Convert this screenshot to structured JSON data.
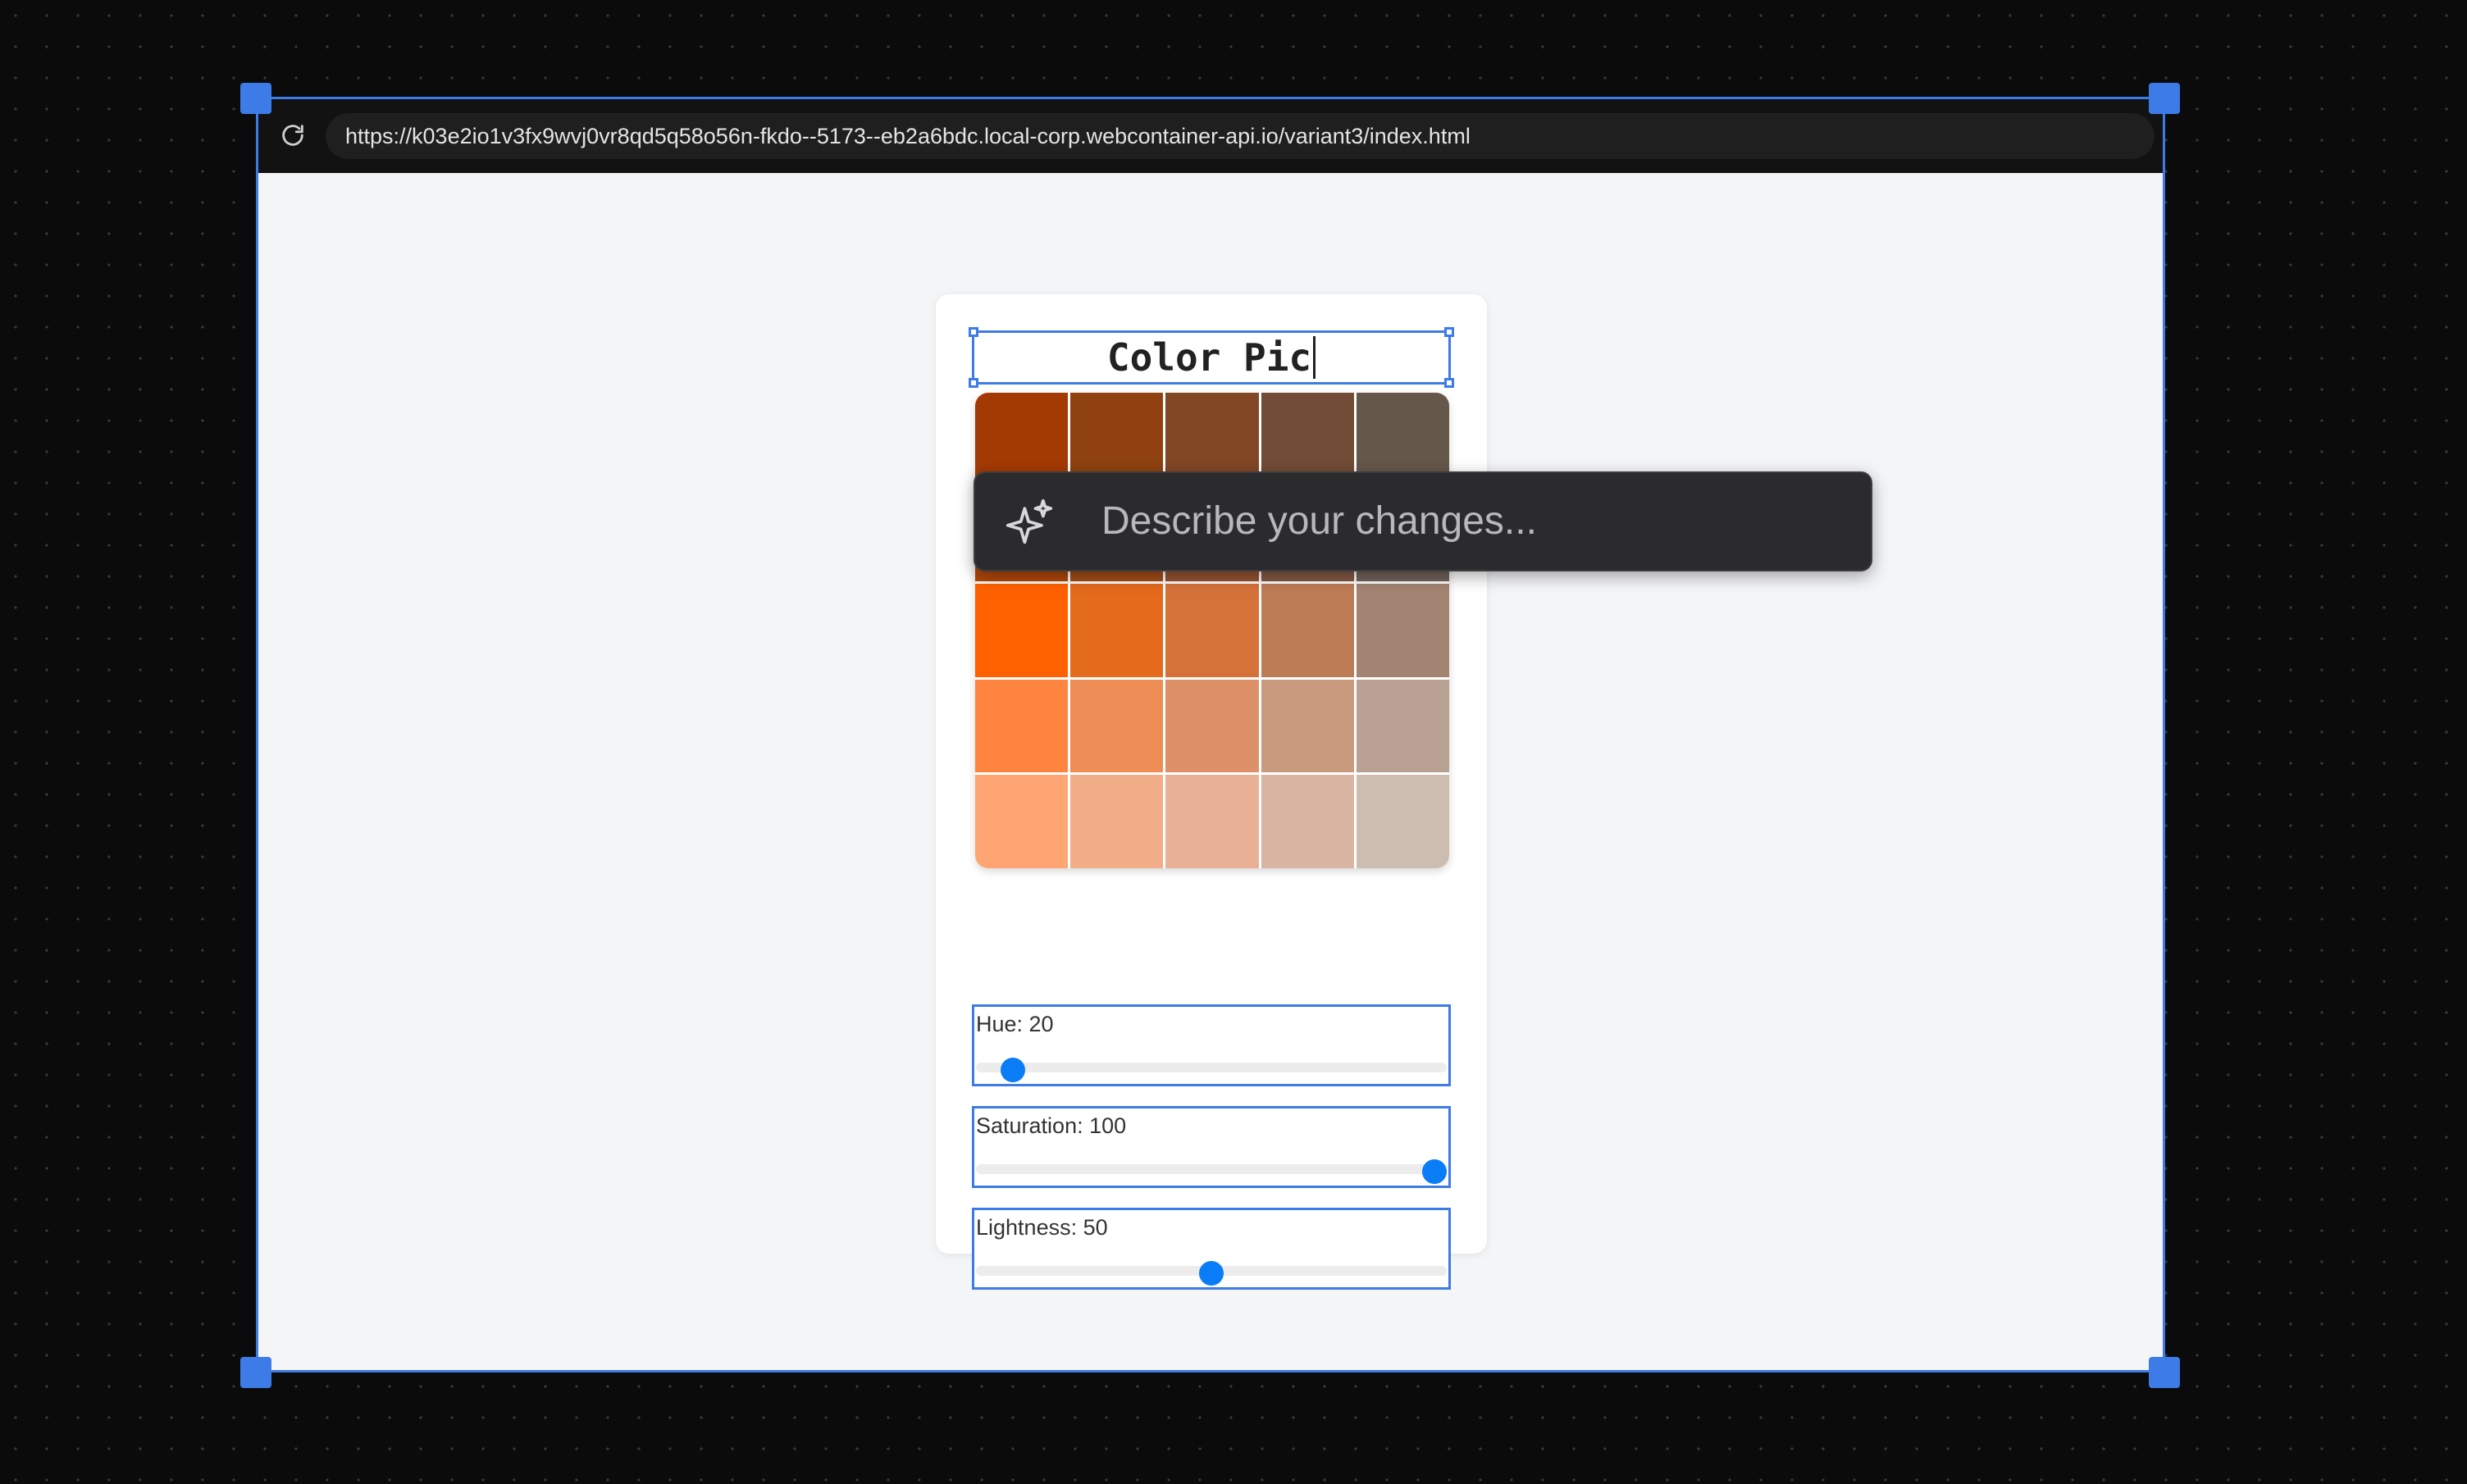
{
  "browser": {
    "url": "https://k03e2io1v3fx9wvj0vr8qd5q58o56n-fkdo--5173--eb2a6bdc.local-corp.webcontainer-api.io/variant3/index.html",
    "reload_icon": "reload-icon"
  },
  "app": {
    "title": "Color Pic",
    "swatches": [
      [
        "#a33a04",
        "#8f420f",
        "#824725",
        "#724c36",
        "#66574b"
      ],
      [
        "#b2470a",
        "#a44d18",
        "#965431",
        "#845a44",
        "#72635b"
      ],
      [
        "#c04f0c",
        "#b5551c",
        "#a25d36",
        "#8e6450",
        "#7e6c62"
      ],
      [
        "#ff6100",
        "#e46a1c",
        "#d5723a",
        "#bd7c56",
        "#a38472"
      ],
      [
        "#ff843f",
        "#ee8e56",
        "#de9168",
        "#ca9a7f",
        "#b8a093"
      ],
      [
        "#ffa574",
        "#f0ad88",
        "#e8b095",
        "#d9b4a3",
        "#cdbcb0"
      ]
    ],
    "sliders": [
      {
        "label": "Hue: 20",
        "value": 20,
        "max": 360
      },
      {
        "label": "Saturation: 100",
        "value": 100,
        "max": 100
      },
      {
        "label": "Lightness: 50",
        "value": 50,
        "max": 100
      }
    ]
  },
  "ai_prompt": {
    "placeholder": "Describe your changes...",
    "icon": "sparkle-icon"
  }
}
